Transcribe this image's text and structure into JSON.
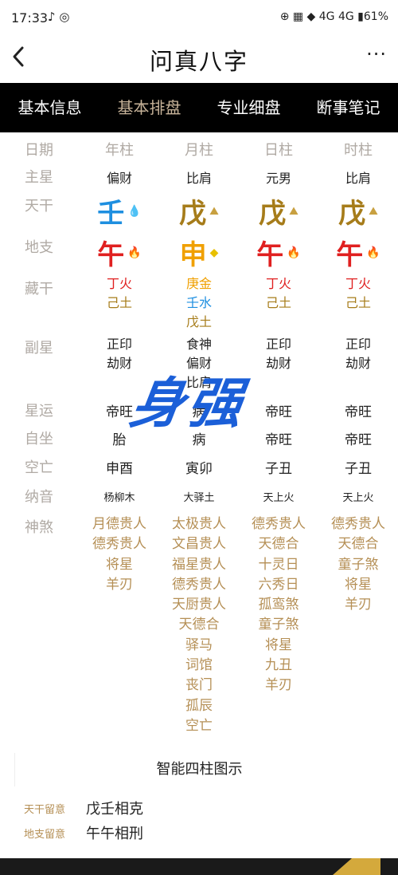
{
  "status": {
    "time": "17:33",
    "left_icons": "♪ ◎",
    "right": "⊕ ▦ ◆ 4G 4G ▮61%"
  },
  "header": {
    "title": "问真八字",
    "more": "···"
  },
  "tabs": [
    {
      "label": "基本信息"
    },
    {
      "label": "基本排盘"
    },
    {
      "label": "专业细盘"
    },
    {
      "label": "断事笔记"
    }
  ],
  "labels": {
    "date": "日期",
    "main_star": "主星",
    "stem": "天干",
    "branch": "地支",
    "hidden": "藏干",
    "sub_star": "副星",
    "star_luck": "星运",
    "self_seat": "自坐",
    "void": "空亡",
    "nayin": "纳音",
    "shensha": "神煞"
  },
  "columns": [
    {
      "header": "年柱",
      "main_star": "偏财",
      "stem": "壬",
      "stem_color": "#1e8fe0",
      "stem_icon": "💧",
      "branch": "午",
      "branch_color": "#e02020",
      "branch_icon": "🔥",
      "hidden": [
        {
          "t": "丁火",
          "c": "#e02020"
        },
        {
          "t": "己土",
          "c": "#a67c1a"
        }
      ],
      "sub": [
        "正印",
        "劫财"
      ],
      "star_luck": "帝旺",
      "self_seat": "胎",
      "void": "申酉",
      "nayin": "杨柳木",
      "shensha": [
        "月德贵人",
        "德秀贵人",
        "将星",
        "羊刃"
      ]
    },
    {
      "header": "月柱",
      "main_star": "比肩",
      "stem": "戊",
      "stem_color": "#a67c1a",
      "stem_icon": "⛰",
      "branch": "申",
      "branch_color": "#f0a000",
      "branch_icon": "◆",
      "hidden": [
        {
          "t": "庚金",
          "c": "#f0a000"
        },
        {
          "t": "壬水",
          "c": "#1e8fe0"
        },
        {
          "t": "戊土",
          "c": "#a67c1a"
        }
      ],
      "sub": [
        "食神",
        "偏财",
        "比肩"
      ],
      "star_luck": "病",
      "self_seat": "病",
      "void": "寅卯",
      "nayin": "大驿土",
      "shensha": [
        "太极贵人",
        "文昌贵人",
        "福星贵人",
        "德秀贵人",
        "天厨贵人",
        "天德合",
        "驿马",
        "词馆",
        "丧门",
        "孤辰",
        "空亡"
      ]
    },
    {
      "header": "日柱",
      "main_star": "元男",
      "stem": "戊",
      "stem_color": "#a67c1a",
      "stem_icon": "⛰",
      "branch": "午",
      "branch_color": "#e02020",
      "branch_icon": "🔥",
      "hidden": [
        {
          "t": "丁火",
          "c": "#e02020"
        },
        {
          "t": "己土",
          "c": "#a67c1a"
        }
      ],
      "sub": [
        "正印",
        "劫财"
      ],
      "star_luck": "帝旺",
      "self_seat": "帝旺",
      "void": "子丑",
      "nayin": "天上火",
      "shensha": [
        "德秀贵人",
        "天德合",
        "十灵日",
        "六秀日",
        "孤鸾煞",
        "童子煞",
        "将星",
        "九丑",
        "羊刃"
      ]
    },
    {
      "header": "时柱",
      "main_star": "比肩",
      "stem": "戊",
      "stem_color": "#a67c1a",
      "stem_icon": "⛰",
      "branch": "午",
      "branch_color": "#e02020",
      "branch_icon": "🔥",
      "hidden": [
        {
          "t": "丁火",
          "c": "#e02020"
        },
        {
          "t": "己土",
          "c": "#a67c1a"
        }
      ],
      "sub": [
        "正印",
        "劫财"
      ],
      "star_luck": "帝旺",
      "self_seat": "帝旺",
      "void": "子丑",
      "nayin": "天上火",
      "shensha": [
        "德秀贵人",
        "天德合",
        "童子煞",
        "将星",
        "羊刃"
      ]
    }
  ],
  "watermark": "身强",
  "section_title": "智能四柱图示",
  "notes": [
    {
      "label": "天干留意",
      "value": "戊壬相克"
    },
    {
      "label": "地支留意",
      "value": "午午相刑"
    }
  ]
}
